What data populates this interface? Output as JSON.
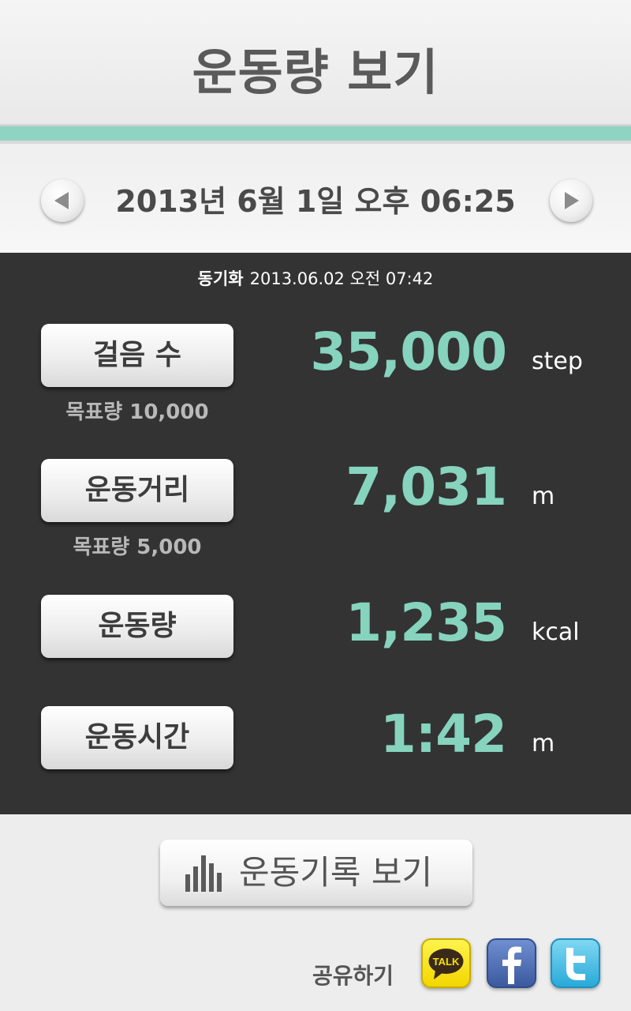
{
  "header": {
    "title": "운동량 보기"
  },
  "datebar": {
    "datetime": "2013년 6월 1일 오후 06:25",
    "prev_icon": "triangle-left-icon",
    "next_icon": "triangle-right-icon"
  },
  "sync": {
    "label": "동기화",
    "value": "2013.06.02 오전 07:42"
  },
  "metrics": [
    {
      "button_label": "걸음 수",
      "value": "35,000",
      "unit": "step",
      "goal": "목표량 10,000"
    },
    {
      "button_label": "운동거리",
      "value": "7,031",
      "unit": "m",
      "goal": "목표량 5,000"
    },
    {
      "button_label": "운동량",
      "value": "1,235",
      "unit": "kcal",
      "goal": ""
    },
    {
      "button_label": "운동시간",
      "value": "1:42",
      "unit": "m",
      "goal": ""
    }
  ],
  "history_button": {
    "label": "운동기록 보기",
    "icon": "bar-chart-icon"
  },
  "share": {
    "label": "공유하기",
    "kakao_text": "TALK",
    "icons": [
      "kakaotalk-icon",
      "facebook-icon",
      "twitter-icon"
    ]
  },
  "colors": {
    "accent": "#86d3be",
    "panel": "#333333",
    "band": "#8fd3c3"
  }
}
